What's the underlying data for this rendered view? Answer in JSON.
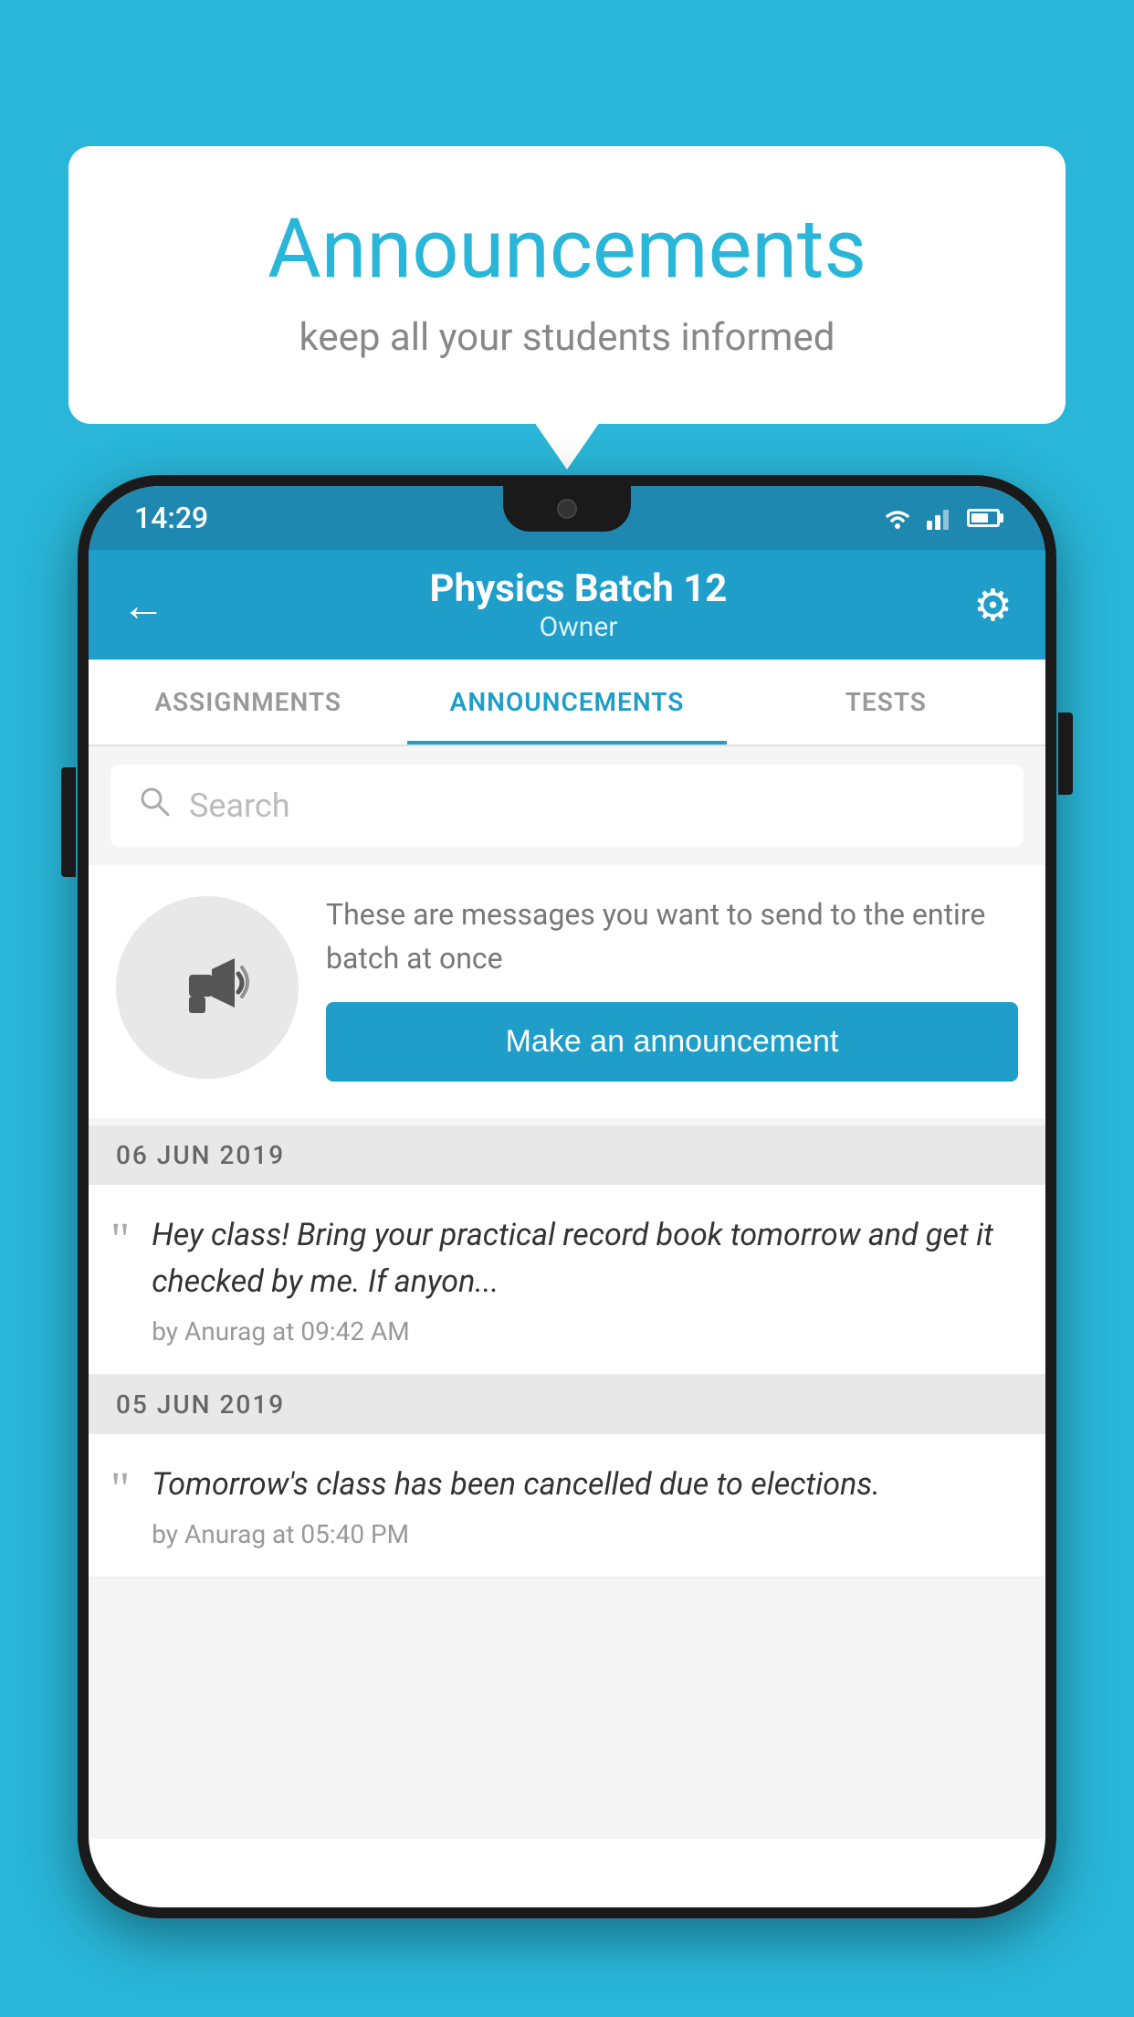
{
  "background_color": "#29b6d8",
  "speech_bubble": {
    "title": "Announcements",
    "subtitle": "keep all your students informed"
  },
  "phone": {
    "status_bar": {
      "time": "14:29"
    },
    "app_bar": {
      "title": "Physics Batch 12",
      "subtitle": "Owner",
      "back_label": "←",
      "gear_label": "⚙"
    },
    "tabs": [
      {
        "label": "ASSIGNMENTS",
        "active": false
      },
      {
        "label": "ANNOUNCEMENTS",
        "active": true
      },
      {
        "label": "TESTS",
        "active": false
      }
    ],
    "search": {
      "placeholder": "Search"
    },
    "promo": {
      "description": "These are messages you want to send to the entire batch at once",
      "button_label": "Make an announcement"
    },
    "announcements": [
      {
        "date": "06  JUN  2019",
        "items": [
          {
            "text": "Hey class! Bring your practical record book tomorrow and get it checked by me. If anyon...",
            "meta": "by Anurag at 09:42 AM"
          }
        ]
      },
      {
        "date": "05  JUN  2019",
        "items": [
          {
            "text": "Tomorrow's class has been cancelled due to elections.",
            "meta": "by Anurag at 05:40 PM"
          }
        ]
      }
    ]
  }
}
